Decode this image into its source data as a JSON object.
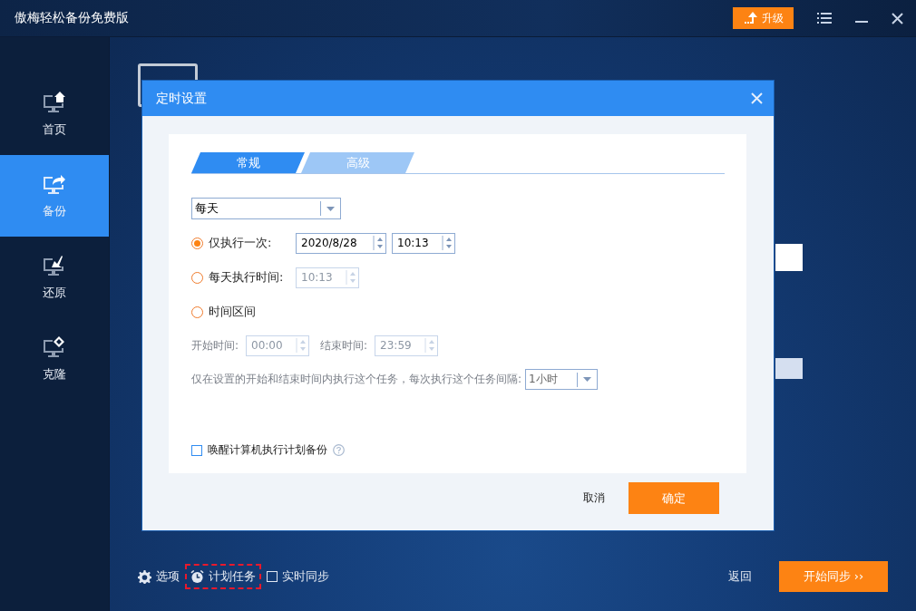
{
  "window": {
    "title": "傲梅轻松备份免费版",
    "upgrade_label": "升级"
  },
  "sidebar": {
    "items": [
      {
        "kind": "home",
        "label": "首页",
        "selected": false
      },
      {
        "kind": "backup",
        "label": "备份",
        "selected": true
      },
      {
        "kind": "restore",
        "label": "还原",
        "selected": false
      },
      {
        "kind": "clone",
        "label": "克隆",
        "selected": false
      }
    ]
  },
  "dialog": {
    "title": "定时设置",
    "tabs": [
      {
        "label": "常规",
        "selected": true
      },
      {
        "label": "高级",
        "selected": false
      }
    ],
    "frequency": {
      "value": "每天"
    },
    "options": [
      {
        "label": "仅执行一次:",
        "selected": true,
        "fields": [
          {
            "kind": "date",
            "value": "2020/8/28",
            "disabled": false
          },
          {
            "kind": "time",
            "value": "10:13",
            "disabled": false
          }
        ]
      },
      {
        "label": "每天执行时间:",
        "selected": false,
        "fields": [
          {
            "kind": "time",
            "value": "10:13",
            "disabled": true
          }
        ]
      },
      {
        "label": "时间区间",
        "selected": false
      }
    ],
    "range": {
      "start_label": "开始时间:",
      "start_value": "00:00",
      "end_label": "结束时间:",
      "end_value": "23:59",
      "disabled": true,
      "note": "仅在设置的开始和结束时间内执行这个任务，每次执行这个任务间隔:",
      "interval": "1小时"
    },
    "wake": {
      "label": "唤醒计算机执行计划备份",
      "checked": false
    },
    "cancel": "取消",
    "ok": "确定"
  },
  "bottom": {
    "options_label": "选项",
    "schedule": {
      "label": "计划任务",
      "highlighted": true
    },
    "realtime": {
      "label": "实时同步",
      "checked": false
    },
    "back": "返回",
    "start": "开始同步 ››"
  }
}
